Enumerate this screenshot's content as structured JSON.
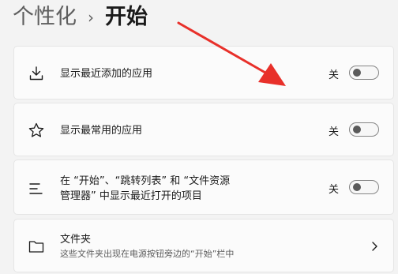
{
  "breadcrumb": {
    "parent": "个性化",
    "separator": "›",
    "current": "开始"
  },
  "settings": [
    {
      "label": "显示最近添加的应用",
      "state": "关",
      "icon": "download-icon",
      "toggle_on": false
    },
    {
      "label": "显示最常用的应用",
      "state": "关",
      "icon": "star-icon",
      "toggle_on": false
    },
    {
      "label_line1": "在 “开始”、“跳转列表” 和 “文件资源",
      "label_line2": "管理器” 中显示最近打开的项目",
      "state": "关",
      "icon": "list-icon",
      "toggle_on": false
    },
    {
      "label": "文件夹",
      "description": "这些文件夹出现在电源按钮旁边的“开始”栏中",
      "icon": "folder-icon"
    }
  ],
  "colors": {
    "background": "#f3f3f3",
    "card": "#fbfbfb",
    "annotation_arrow": "#e8302a"
  }
}
